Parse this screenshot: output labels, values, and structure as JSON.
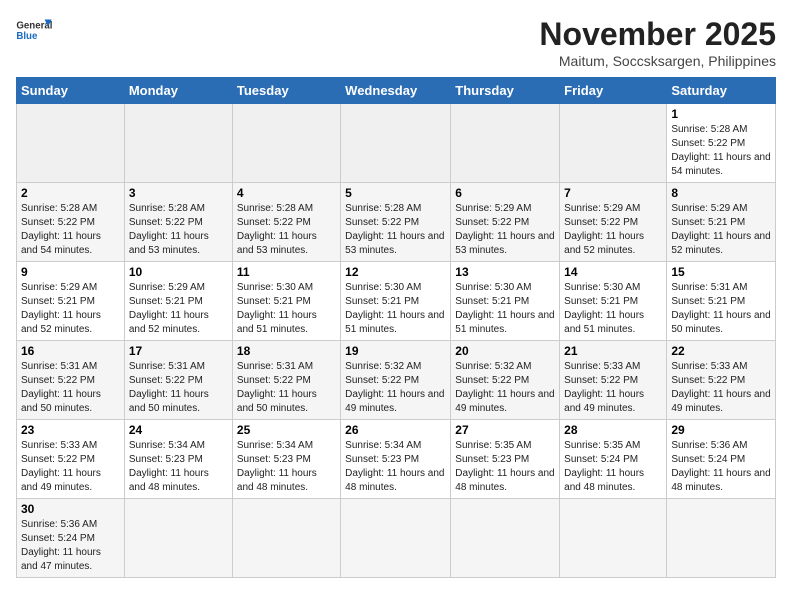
{
  "logo": {
    "text_general": "General",
    "text_blue": "Blue"
  },
  "header": {
    "month_year": "November 2025",
    "location": "Maitum, Soccsksargen, Philippines"
  },
  "weekdays": [
    "Sunday",
    "Monday",
    "Tuesday",
    "Wednesday",
    "Thursday",
    "Friday",
    "Saturday"
  ],
  "weeks": [
    [
      null,
      null,
      null,
      null,
      null,
      null,
      {
        "day": "1",
        "sunrise": "Sunrise: 5:28 AM",
        "sunset": "Sunset: 5:22 PM",
        "daylight": "Daylight: 11 hours and 54 minutes."
      }
    ],
    [
      {
        "day": "2",
        "sunrise": "Sunrise: 5:28 AM",
        "sunset": "Sunset: 5:22 PM",
        "daylight": "Daylight: 11 hours and 54 minutes."
      },
      {
        "day": "3",
        "sunrise": "Sunrise: 5:28 AM",
        "sunset": "Sunset: 5:22 PM",
        "daylight": "Daylight: 11 hours and 53 minutes."
      },
      {
        "day": "4",
        "sunrise": "Sunrise: 5:28 AM",
        "sunset": "Sunset: 5:22 PM",
        "daylight": "Daylight: 11 hours and 53 minutes."
      },
      {
        "day": "5",
        "sunrise": "Sunrise: 5:28 AM",
        "sunset": "Sunset: 5:22 PM",
        "daylight": "Daylight: 11 hours and 53 minutes."
      },
      {
        "day": "6",
        "sunrise": "Sunrise: 5:29 AM",
        "sunset": "Sunset: 5:22 PM",
        "daylight": "Daylight: 11 hours and 53 minutes."
      },
      {
        "day": "7",
        "sunrise": "Sunrise: 5:29 AM",
        "sunset": "Sunset: 5:22 PM",
        "daylight": "Daylight: 11 hours and 52 minutes."
      },
      {
        "day": "8",
        "sunrise": "Sunrise: 5:29 AM",
        "sunset": "Sunset: 5:21 PM",
        "daylight": "Daylight: 11 hours and 52 minutes."
      }
    ],
    [
      {
        "day": "9",
        "sunrise": "Sunrise: 5:29 AM",
        "sunset": "Sunset: 5:21 PM",
        "daylight": "Daylight: 11 hours and 52 minutes."
      },
      {
        "day": "10",
        "sunrise": "Sunrise: 5:29 AM",
        "sunset": "Sunset: 5:21 PM",
        "daylight": "Daylight: 11 hours and 52 minutes."
      },
      {
        "day": "11",
        "sunrise": "Sunrise: 5:30 AM",
        "sunset": "Sunset: 5:21 PM",
        "daylight": "Daylight: 11 hours and 51 minutes."
      },
      {
        "day": "12",
        "sunrise": "Sunrise: 5:30 AM",
        "sunset": "Sunset: 5:21 PM",
        "daylight": "Daylight: 11 hours and 51 minutes."
      },
      {
        "day": "13",
        "sunrise": "Sunrise: 5:30 AM",
        "sunset": "Sunset: 5:21 PM",
        "daylight": "Daylight: 11 hours and 51 minutes."
      },
      {
        "day": "14",
        "sunrise": "Sunrise: 5:30 AM",
        "sunset": "Sunset: 5:21 PM",
        "daylight": "Daylight: 11 hours and 51 minutes."
      },
      {
        "day": "15",
        "sunrise": "Sunrise: 5:31 AM",
        "sunset": "Sunset: 5:21 PM",
        "daylight": "Daylight: 11 hours and 50 minutes."
      }
    ],
    [
      {
        "day": "16",
        "sunrise": "Sunrise: 5:31 AM",
        "sunset": "Sunset: 5:22 PM",
        "daylight": "Daylight: 11 hours and 50 minutes."
      },
      {
        "day": "17",
        "sunrise": "Sunrise: 5:31 AM",
        "sunset": "Sunset: 5:22 PM",
        "daylight": "Daylight: 11 hours and 50 minutes."
      },
      {
        "day": "18",
        "sunrise": "Sunrise: 5:31 AM",
        "sunset": "Sunset: 5:22 PM",
        "daylight": "Daylight: 11 hours and 50 minutes."
      },
      {
        "day": "19",
        "sunrise": "Sunrise: 5:32 AM",
        "sunset": "Sunset: 5:22 PM",
        "daylight": "Daylight: 11 hours and 49 minutes."
      },
      {
        "day": "20",
        "sunrise": "Sunrise: 5:32 AM",
        "sunset": "Sunset: 5:22 PM",
        "daylight": "Daylight: 11 hours and 49 minutes."
      },
      {
        "day": "21",
        "sunrise": "Sunrise: 5:33 AM",
        "sunset": "Sunset: 5:22 PM",
        "daylight": "Daylight: 11 hours and 49 minutes."
      },
      {
        "day": "22",
        "sunrise": "Sunrise: 5:33 AM",
        "sunset": "Sunset: 5:22 PM",
        "daylight": "Daylight: 11 hours and 49 minutes."
      }
    ],
    [
      {
        "day": "23",
        "sunrise": "Sunrise: 5:33 AM",
        "sunset": "Sunset: 5:22 PM",
        "daylight": "Daylight: 11 hours and 49 minutes."
      },
      {
        "day": "24",
        "sunrise": "Sunrise: 5:34 AM",
        "sunset": "Sunset: 5:23 PM",
        "daylight": "Daylight: 11 hours and 48 minutes."
      },
      {
        "day": "25",
        "sunrise": "Sunrise: 5:34 AM",
        "sunset": "Sunset: 5:23 PM",
        "daylight": "Daylight: 11 hours and 48 minutes."
      },
      {
        "day": "26",
        "sunrise": "Sunrise: 5:34 AM",
        "sunset": "Sunset: 5:23 PM",
        "daylight": "Daylight: 11 hours and 48 minutes."
      },
      {
        "day": "27",
        "sunrise": "Sunrise: 5:35 AM",
        "sunset": "Sunset: 5:23 PM",
        "daylight": "Daylight: 11 hours and 48 minutes."
      },
      {
        "day": "28",
        "sunrise": "Sunrise: 5:35 AM",
        "sunset": "Sunset: 5:24 PM",
        "daylight": "Daylight: 11 hours and 48 minutes."
      },
      {
        "day": "29",
        "sunrise": "Sunrise: 5:36 AM",
        "sunset": "Sunset: 5:24 PM",
        "daylight": "Daylight: 11 hours and 48 minutes."
      }
    ],
    [
      {
        "day": "30",
        "sunrise": "Sunrise: 5:36 AM",
        "sunset": "Sunset: 5:24 PM",
        "daylight": "Daylight: 11 hours and 47 minutes."
      },
      null,
      null,
      null,
      null,
      null,
      null
    ]
  ]
}
